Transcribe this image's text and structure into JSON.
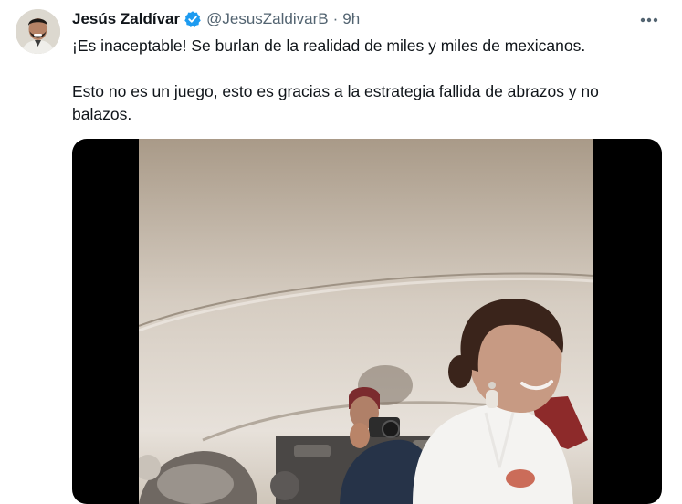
{
  "author": {
    "name": "Jesús Zaldívar",
    "handle": "@JesusZaldivarB",
    "separator": "·",
    "time": "9h",
    "verified": true
  },
  "tweet": {
    "line1": "¡Es inaceptable! Se burlan de la realidad de miles y miles de mexicanos.",
    "line2": "Esto no es un juego, esto es gracias a la estrategia fallida de abrazos y no balazos."
  },
  "icons": {
    "verified": "verified-badge-icon",
    "more": "more-options-icon"
  },
  "colors": {
    "verified": "#1d9bf0",
    "secondary_text": "#536471",
    "primary_text": "#0f1419",
    "media_bg": "#000000"
  }
}
